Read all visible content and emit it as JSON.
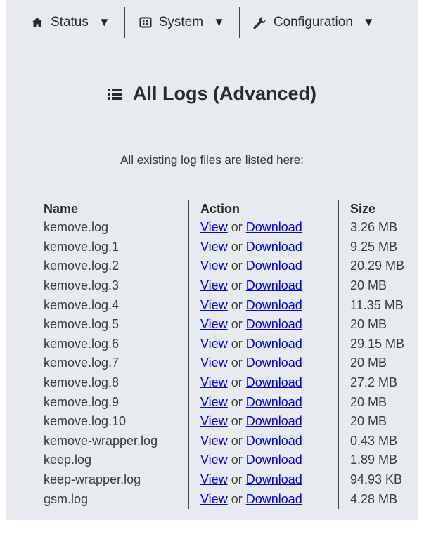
{
  "nav": {
    "status": {
      "label": "Status",
      "icon": "home-icon"
    },
    "system": {
      "label": "System",
      "icon": "system-icon"
    },
    "configuration": {
      "label": "Configuration",
      "icon": "wrench-icon"
    }
  },
  "page": {
    "title": "All Logs (Advanced)",
    "subtitle": "All existing log files are listed here:"
  },
  "table": {
    "headers": {
      "name": "Name",
      "action": "Action",
      "size": "Size"
    },
    "view_label": "View",
    "or_label": "or",
    "download_label": "Download",
    "rows": [
      {
        "name": "kemove.log",
        "size": "3.26 MB"
      },
      {
        "name": "kemove.log.1",
        "size": "9.25 MB"
      },
      {
        "name": "kemove.log.2",
        "size": "20.29 MB"
      },
      {
        "name": "kemove.log.3",
        "size": "20 MB"
      },
      {
        "name": "kemove.log.4",
        "size": "11.35 MB"
      },
      {
        "name": "kemove.log.5",
        "size": "20 MB"
      },
      {
        "name": "kemove.log.6",
        "size": "29.15 MB"
      },
      {
        "name": "kemove.log.7",
        "size": "20 MB"
      },
      {
        "name": "kemove.log.8",
        "size": "27.2 MB"
      },
      {
        "name": "kemove.log.9",
        "size": "20 MB"
      },
      {
        "name": "kemove.log.10",
        "size": "20 MB"
      },
      {
        "name": "kemove-wrapper.log",
        "size": "0.43 MB"
      },
      {
        "name": "keep.log",
        "size": "1.89 MB"
      },
      {
        "name": "keep-wrapper.log",
        "size": "94.93 KB"
      },
      {
        "name": "gsm.log",
        "size": "4.28 MB"
      }
    ]
  },
  "colors": {
    "panel_bg": "#e7eaee",
    "link": "#0000ee",
    "text": "#3a3a3a"
  }
}
